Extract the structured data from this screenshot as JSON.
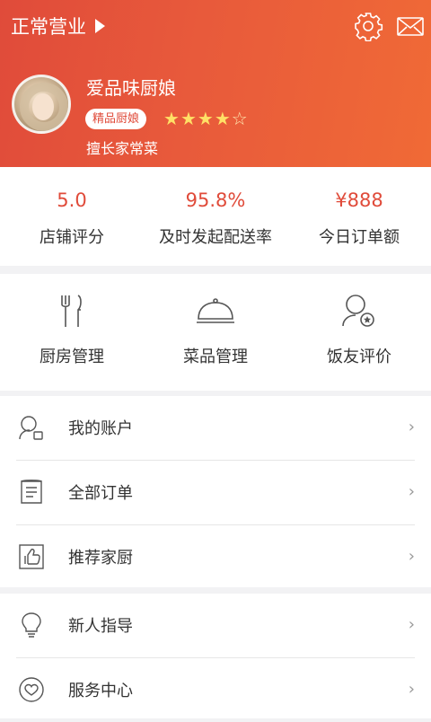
{
  "header": {
    "status_label": "正常营业",
    "name": "爱品味厨娘",
    "badge": "精品厨娘",
    "specialty": "擅长家常菜",
    "rating": {
      "value": 4,
      "max": 5
    },
    "icons": [
      "settings-gear-icon",
      "mail-icon"
    ]
  },
  "stats": [
    {
      "value": "5.0",
      "label": "店铺评分"
    },
    {
      "value": "95.8%",
      "label": "及时发起配送率"
    },
    {
      "value": "¥888",
      "label": "今日订单额"
    }
  ],
  "tiles": [
    {
      "label": "厨房管理",
      "icon": "fork-knife-icon"
    },
    {
      "label": "菜品管理",
      "icon": "dish-cover-icon"
    },
    {
      "label": "饭友评价",
      "icon": "user-review-icon"
    }
  ],
  "menu": [
    {
      "label": "我的账户",
      "icon": "account-icon"
    },
    {
      "label": "全部订单",
      "icon": "orders-icon"
    },
    {
      "label": "推荐家厨",
      "icon": "thumbs-up-icon"
    },
    {
      "label": "新人指导",
      "icon": "lightbulb-icon"
    },
    {
      "label": "服务中心",
      "icon": "heart-icon"
    }
  ],
  "colors": {
    "accent": "#e04b3a",
    "header_end": "#f06a36",
    "star": "#ffe066"
  }
}
